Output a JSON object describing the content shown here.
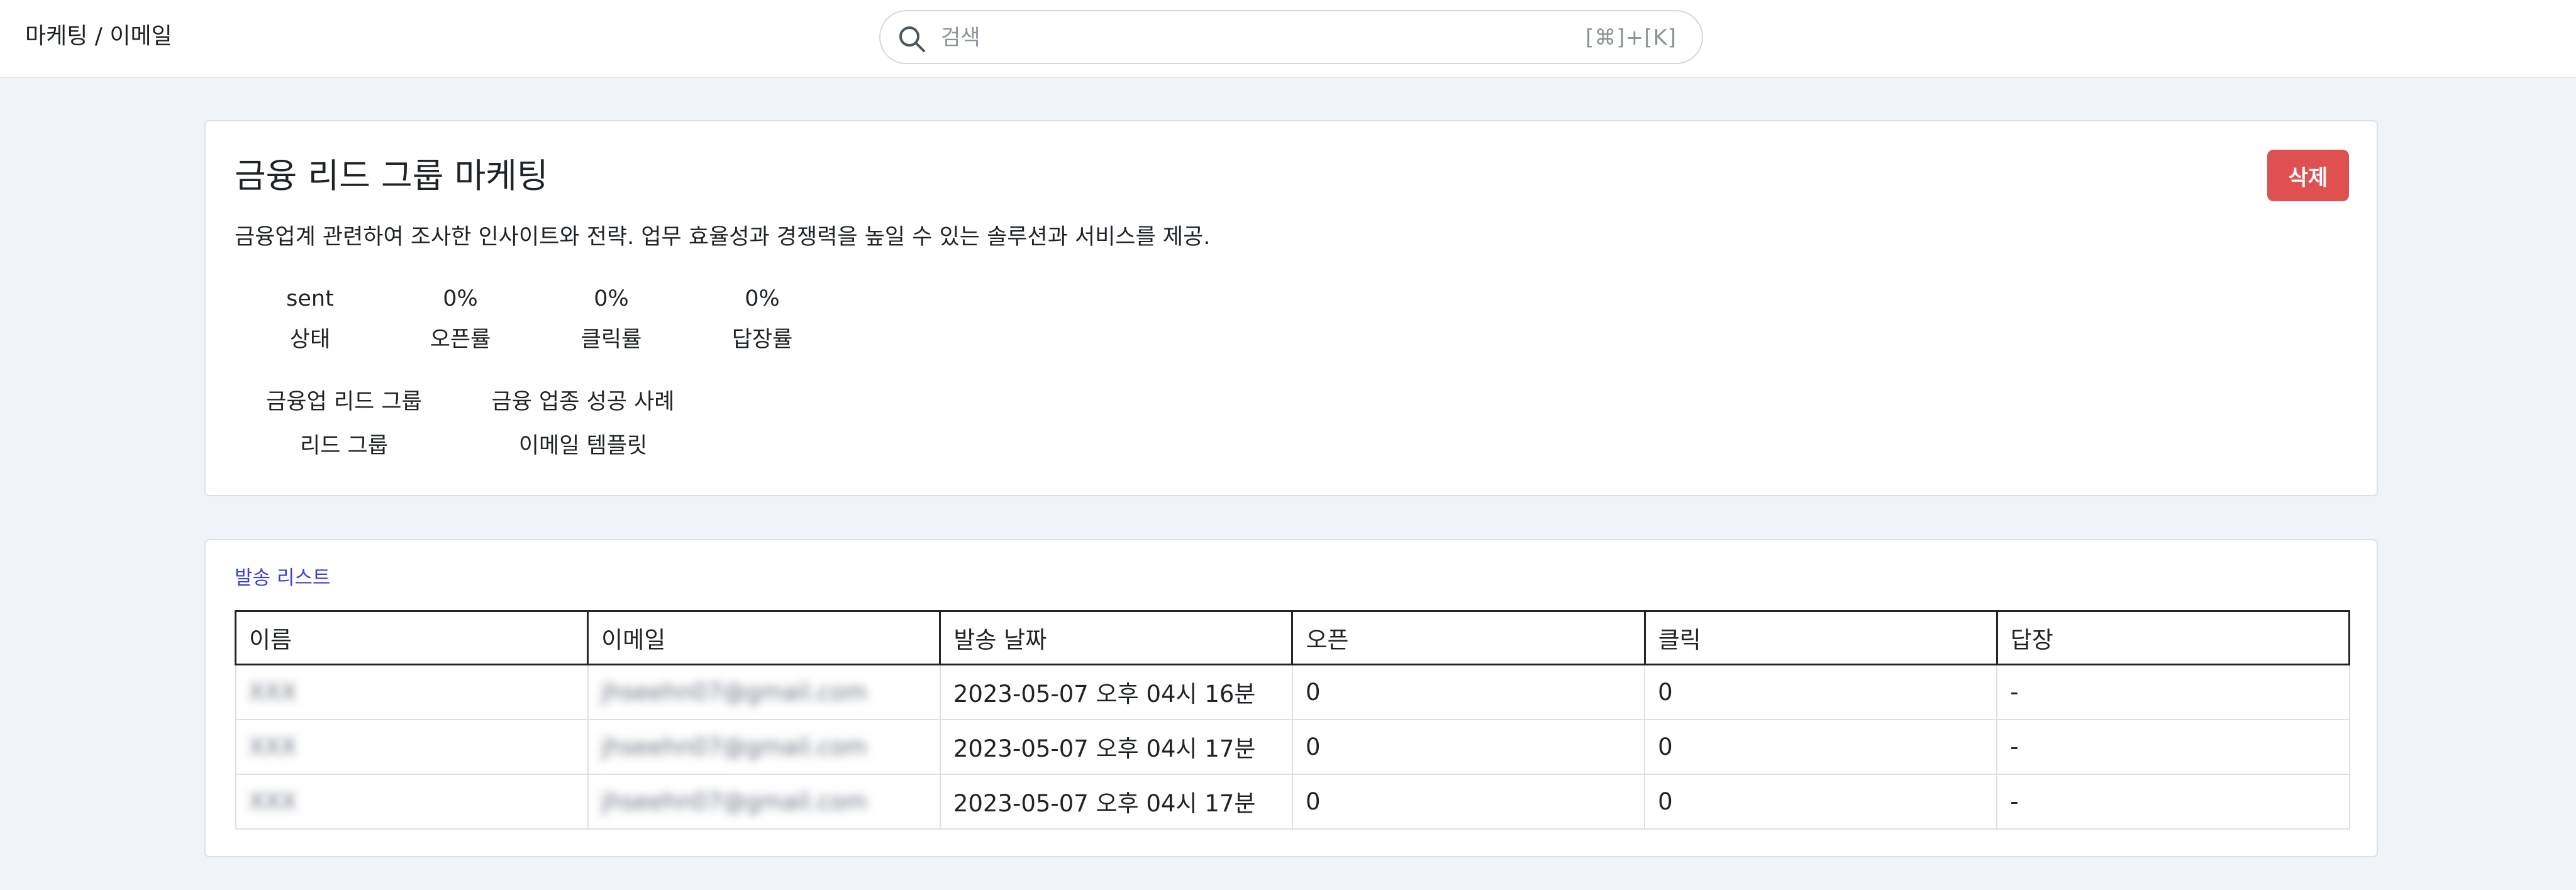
{
  "header": {
    "breadcrumb": "마케팅 / 이메일",
    "search": {
      "placeholder": "검색",
      "shortcut": "[⌘]+[K]"
    }
  },
  "campaign": {
    "title": "금융 리드 그룹 마케팅",
    "delete_label": "삭제",
    "description": "금융업계 관련하여 조사한 인사이트와 전략. 업무 효율성과 경쟁력을 높일 수 있는 솔루션과 서비스를 제공.",
    "stats": {
      "status": {
        "value": "sent",
        "label": "상태"
      },
      "open_rate": {
        "value": "0%",
        "label": "오픈률"
      },
      "click_rate": {
        "value": "0%",
        "label": "클릭률"
      },
      "reply_rate": {
        "value": "0%",
        "label": "답장률"
      }
    },
    "lead_group": {
      "value": "금융업 리드 그룹",
      "label": "리드 그룹"
    },
    "email_template": {
      "value": "금융 업종 성공 사례",
      "label": "이메일 템플릿"
    }
  },
  "send_list": {
    "title": "발송 리스트",
    "columns": [
      "이름",
      "이메일",
      "발송 날짜",
      "오픈",
      "클릭",
      "답장"
    ],
    "rows": [
      {
        "name": "XXX",
        "email": "jhseehn07@gmail.com",
        "sent_at": "2023-05-07 오후 04시 16분",
        "open": "0",
        "click": "0",
        "reply": "-"
      },
      {
        "name": "XXX",
        "email": "jhseehn07@gmail.com",
        "sent_at": "2023-05-07 오후 04시 17분",
        "open": "0",
        "click": "0",
        "reply": "-"
      },
      {
        "name": "XXX",
        "email": "jhseehn07@gmail.com",
        "sent_at": "2023-05-07 오후 04시 17분",
        "open": "0",
        "click": "0",
        "reply": "-"
      }
    ]
  },
  "colors": {
    "background": "#f0f3f7",
    "delete_button": "#df5151",
    "list_title": "#3b3fd3"
  }
}
